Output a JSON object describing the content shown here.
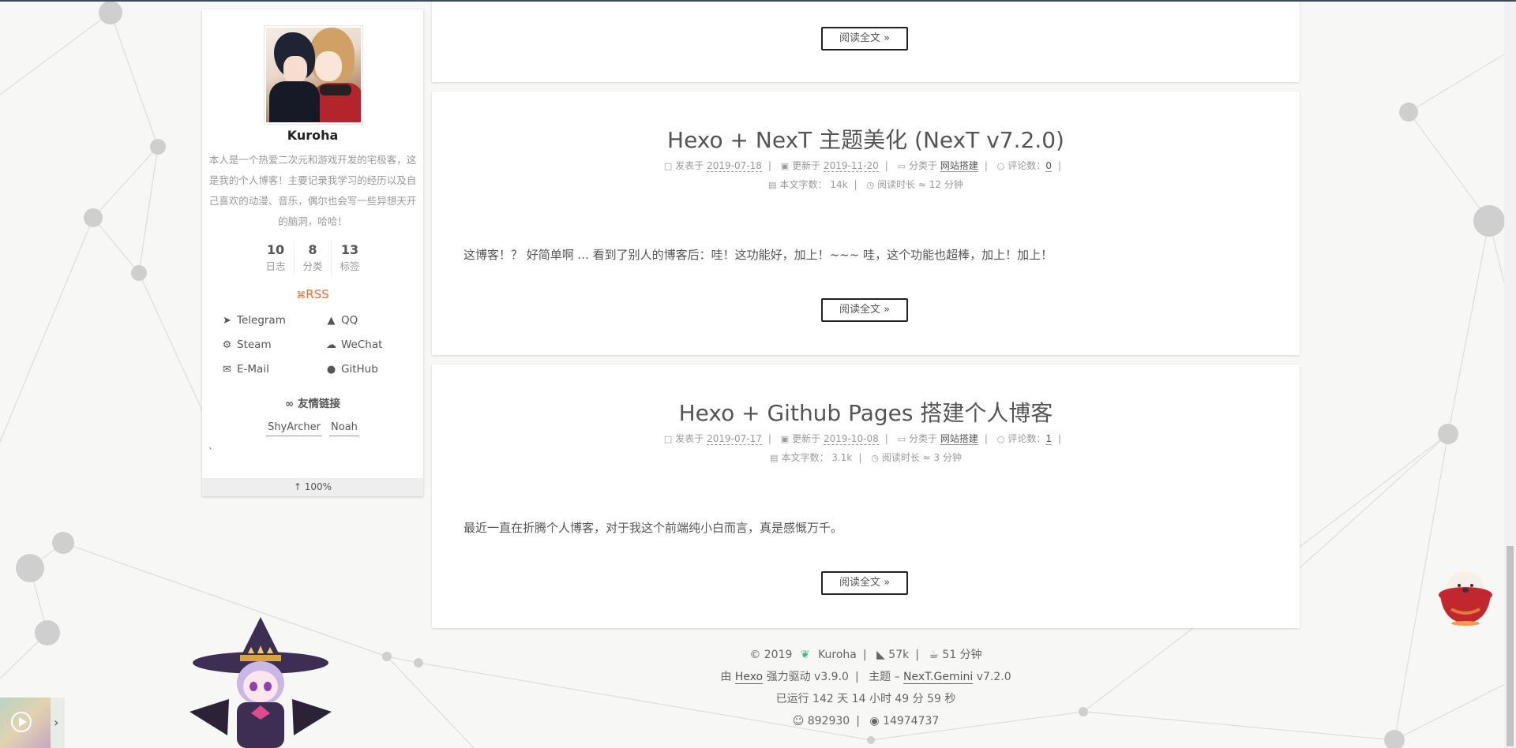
{
  "sidebar": {
    "author": "Kuroha",
    "description": "本人是一个热爱二次元和游戏开发的宅极客，这是我的个人博客！主要记录我学习的经历以及自己喜欢的动漫、音乐，偶尔也会写一些异想天开的脑洞，哈哈！",
    "stats": [
      {
        "count": "10",
        "label": "日志"
      },
      {
        "count": "8",
        "label": "分类"
      },
      {
        "count": "13",
        "label": "标签"
      }
    ],
    "rss": "RSS",
    "social": [
      {
        "label": "Telegram",
        "icon": "telegram-icon"
      },
      {
        "label": "QQ",
        "icon": "qq-icon"
      },
      {
        "label": "Steam",
        "icon": "steam-icon"
      },
      {
        "label": "WeChat",
        "icon": "wechat-icon"
      },
      {
        "label": "E-Mail",
        "icon": "email-icon"
      },
      {
        "label": "GitHub",
        "icon": "github-icon"
      }
    ],
    "friends_title": "友情链接",
    "friends": [
      "ShyArcher",
      "Noah"
    ],
    "backtick": "`",
    "progress": "100%"
  },
  "posts": [
    {
      "read_more": "阅读全文 »"
    },
    {
      "title": "Hexo + NexT 主题美化 (NexT v7.2.0)",
      "posted_label": "发表于",
      "posted_date": "2019-07-18",
      "updated_label": "更新于",
      "updated_date": "2019-11-20",
      "category_label": "分类于",
      "category": "网站搭建",
      "comments_label": "评论数：",
      "comments": "0",
      "wordcount_label": "本文字数：",
      "wordcount": "14k",
      "readtime_label": "阅读时长 ≈",
      "readtime": "12 分钟",
      "excerpt": "这博客！？ 好简单啊 ... 看到了别人的博客后：哇！这功能好，加上！~~~ 哇，这个功能也超棒，加上！加上！",
      "read_more": "阅读全文 »"
    },
    {
      "title": "Hexo + Github Pages 搭建个人博客",
      "posted_label": "发表于",
      "posted_date": "2019-07-17",
      "updated_label": "更新于",
      "updated_date": "2019-10-08",
      "category_label": "分类于",
      "category": "网站搭建",
      "comments_label": "评论数：",
      "comments": "1",
      "wordcount_label": "本文字数：",
      "wordcount": "3.1k",
      "readtime_label": "阅读时长 ≈",
      "readtime": "3 分钟",
      "excerpt": "最近一直在折腾个人博客，对于我这个前端纯小白而言，真是感慨万千。",
      "read_more": "阅读全文 »"
    }
  ],
  "footer": {
    "copyright": "© 2019",
    "author": "Kuroha",
    "total_words": "57k",
    "total_time": "51 分钟",
    "powered_prefix": "由",
    "hexo": "Hexo",
    "powered_suffix": "强力驱动 v3.9.0",
    "theme_prefix": "主题 –",
    "theme": "NexT.Gemini",
    "theme_version": "v7.2.0",
    "runtime": "已运行 142 天 14 小时 49 分 59 秒",
    "visitors": "892930",
    "views": "14974737"
  },
  "colors": {
    "accent": "#222222",
    "rss": "#fc6423",
    "leaf": "#42b983",
    "background": "#f7f7f5"
  }
}
